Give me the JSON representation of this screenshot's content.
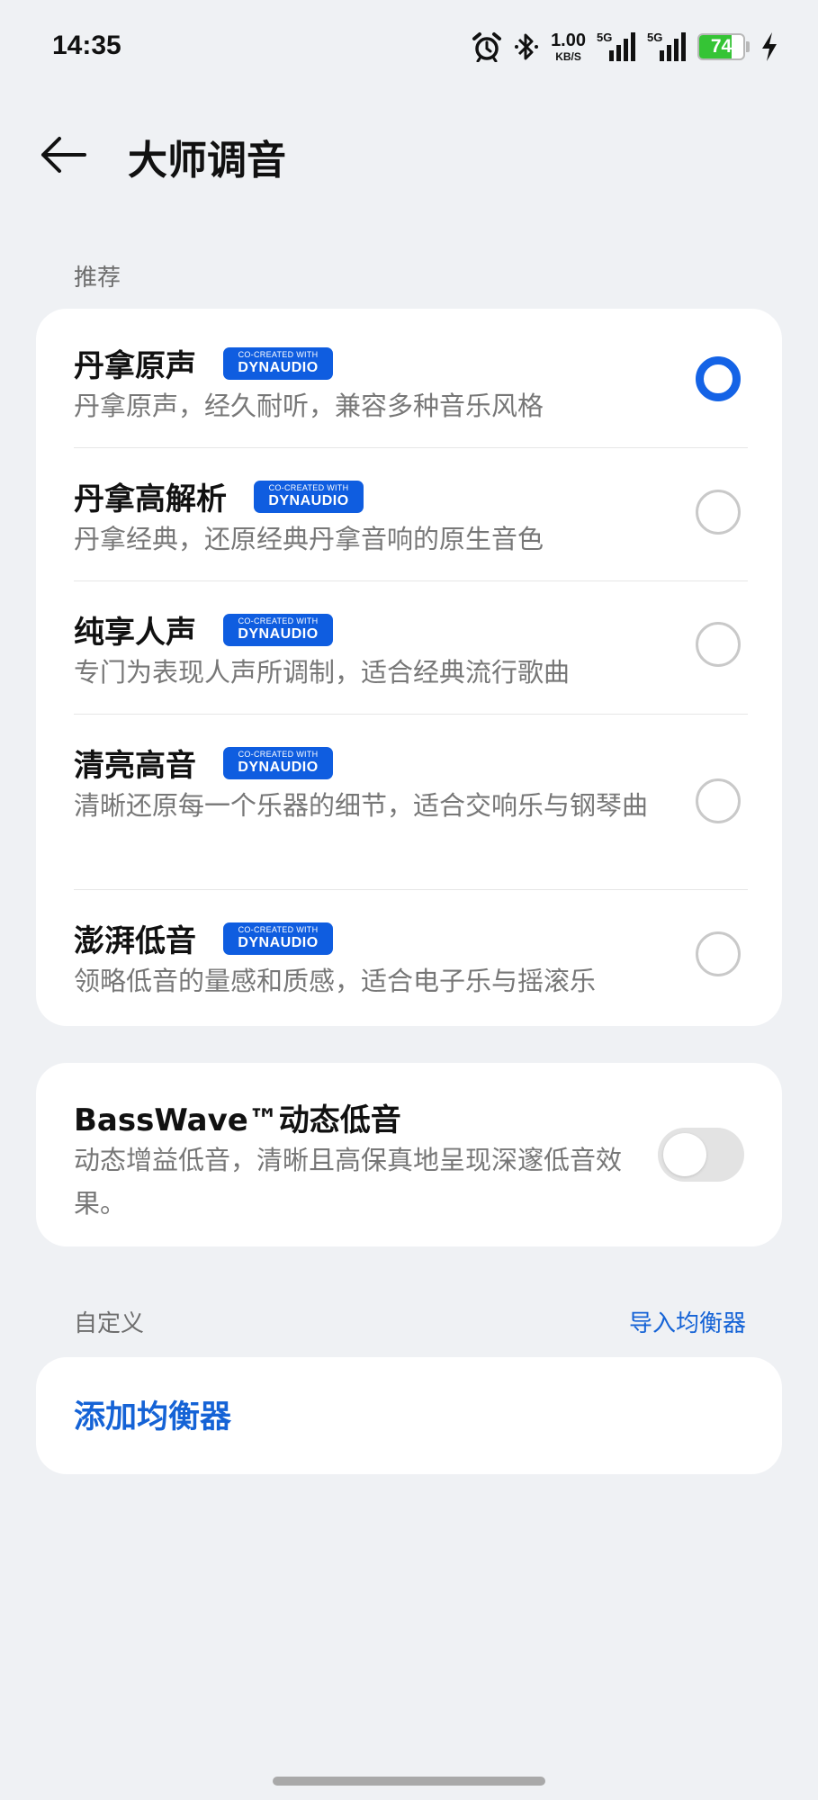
{
  "status_bar": {
    "time": "14:35",
    "speed_value": "1.00",
    "speed_unit": "KB/S",
    "signal1_label": "5G",
    "signal2_label": "5G",
    "battery_level": "74",
    "battery_fraction": 0.74,
    "battery_color": "#35c435"
  },
  "header": {
    "title": "大师调音"
  },
  "recommended": {
    "section_label": "推荐",
    "presets": [
      {
        "title": "丹拿原声",
        "badge_small": "CO-CREATED WITH",
        "badge_big": "DYNAUDIO",
        "desc": "丹拿原声，经久耐听，兼容多种音乐风格",
        "selected": true
      },
      {
        "title": "丹拿高解析",
        "badge_small": "CO-CREATED WITH",
        "badge_big": "DYNAUDIO",
        "desc": "丹拿经典，还原经典丹拿音响的原生音色",
        "selected": false
      },
      {
        "title": "纯享人声",
        "badge_small": "CO-CREATED WITH",
        "badge_big": "DYNAUDIO",
        "desc": "专门为表现人声所调制，适合经典流行歌曲",
        "selected": false
      },
      {
        "title": "清亮高音",
        "badge_small": "CO-CREATED WITH",
        "badge_big": "DYNAUDIO",
        "desc": "清晰还原每一个乐器的细节，适合交响乐与钢琴曲",
        "selected": false
      },
      {
        "title": "澎湃低音",
        "badge_small": "CO-CREATED WITH",
        "badge_big": "DYNAUDIO",
        "desc": "领略低音的量感和质感，适合电子乐与摇滚乐",
        "selected": false
      }
    ]
  },
  "basswave": {
    "title": "BassWave™动态低音",
    "desc": "动态增益低音，清晰且高保真地呈现深邃低音效果。",
    "enabled": false
  },
  "custom": {
    "section_label": "自定义",
    "import_label": "导入均衡器",
    "add_label": "添加均衡器"
  },
  "colors": {
    "accent": "#1463e6",
    "badge": "#0f5de0",
    "link": "#1563d6"
  }
}
